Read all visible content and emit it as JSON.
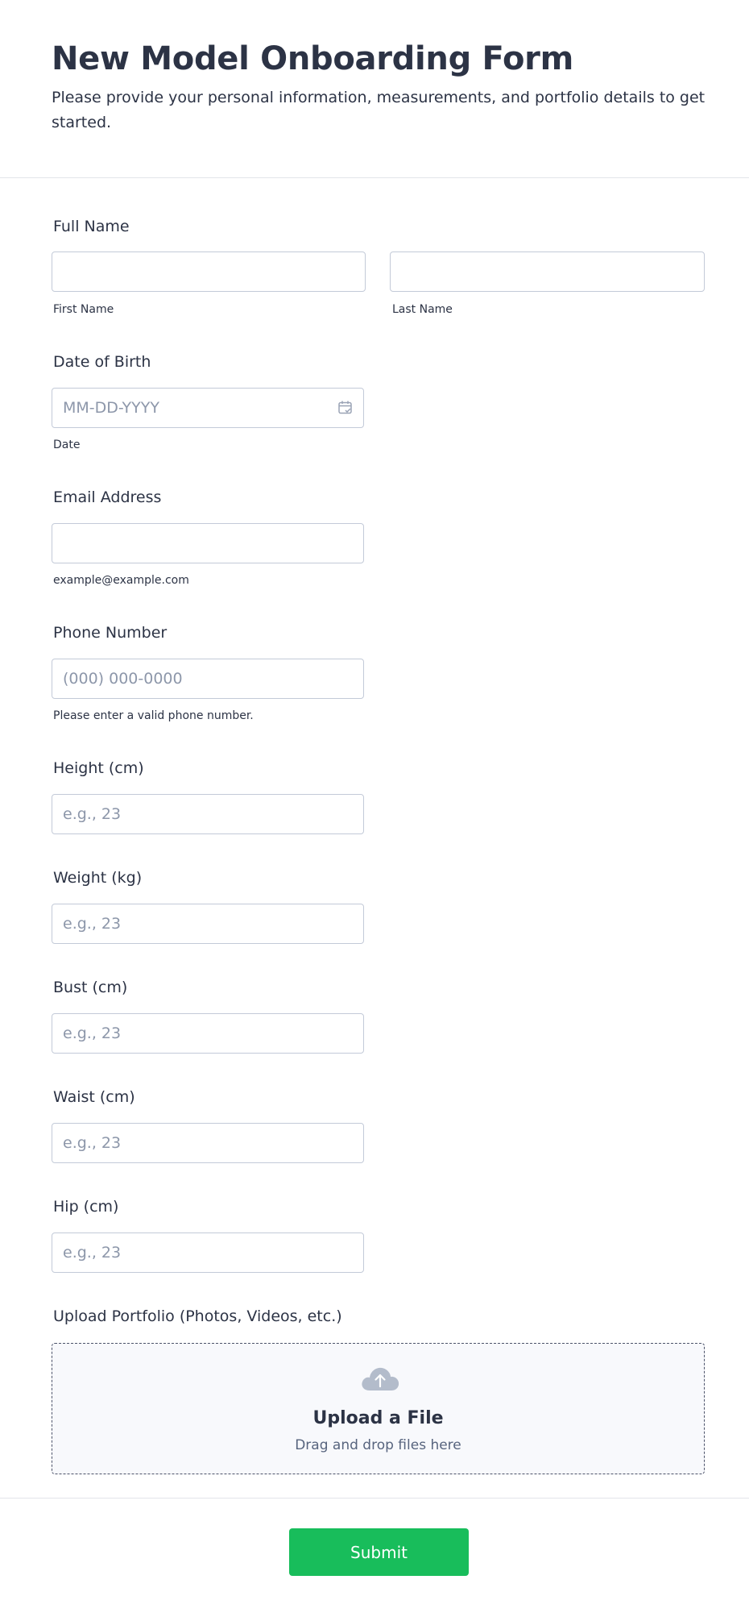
{
  "form": {
    "title": "New Model Onboarding Form",
    "subtitle": "Please provide your personal information, measurements, and portfolio details to get started."
  },
  "fields": {
    "full_name": {
      "label": "Full Name",
      "first_sublabel": "First Name",
      "last_sublabel": "Last Name",
      "first_value": "",
      "last_value": ""
    },
    "dob": {
      "label": "Date of Birth",
      "placeholder": "MM-DD-YYYY",
      "sublabel": "Date",
      "value": ""
    },
    "email": {
      "label": "Email Address",
      "sublabel": "example@example.com",
      "value": ""
    },
    "phone": {
      "label": "Phone Number",
      "placeholder": "(000) 000-0000",
      "sublabel": "Please enter a valid phone number.",
      "value": ""
    },
    "height": {
      "label": "Height (cm)",
      "placeholder": "e.g., 23",
      "value": ""
    },
    "weight": {
      "label": "Weight (kg)",
      "placeholder": "e.g., 23",
      "value": ""
    },
    "bust": {
      "label": "Bust (cm)",
      "placeholder": "e.g., 23",
      "value": ""
    },
    "waist": {
      "label": "Waist (cm)",
      "placeholder": "e.g., 23",
      "value": ""
    },
    "hip": {
      "label": "Hip (cm)",
      "placeholder": "e.g., 23",
      "value": ""
    },
    "portfolio": {
      "label": "Upload Portfolio (Photos, Videos, etc.)",
      "upload_title": "Upload a File",
      "upload_subtitle": "Drag and drop files here"
    }
  },
  "submit": {
    "label": "Submit"
  },
  "icons": {
    "date": "calendar-icon",
    "upload": "cloud-upload-icon"
  },
  "colors": {
    "accent": "#18bd5b",
    "text": "#2c3345",
    "border": "#c3cad8",
    "placeholder": "#8d97aa"
  }
}
